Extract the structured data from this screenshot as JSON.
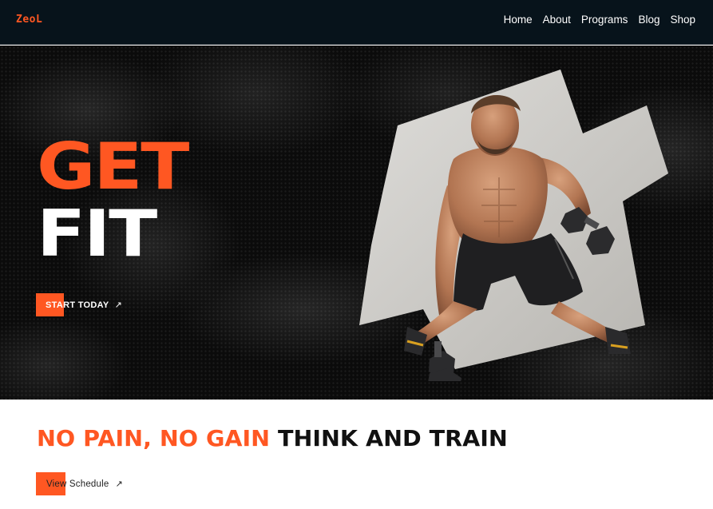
{
  "brand": {
    "logo": "ZeoL"
  },
  "nav": {
    "items": [
      {
        "label": "Home"
      },
      {
        "label": "About"
      },
      {
        "label": "Programs"
      },
      {
        "label": "Blog"
      },
      {
        "label": "Shop"
      }
    ]
  },
  "hero": {
    "title_line1": "GET",
    "title_line2": "FIT",
    "cta_label": "START TODAY",
    "cta_icon": "arrow-up-right-icon",
    "image": "athlete-dumbbell-pushup-photo"
  },
  "section": {
    "tagline_orange": "NO PAIN, NO GAIN",
    "tagline_dark": "THINK AND TRAIN",
    "button_label": "View Schedule",
    "button_icon": "arrow-up-right-icon"
  },
  "colors": {
    "accent": "#ff5722",
    "nav_bg": "#07131b",
    "hero_bg": "#0b0b0b",
    "text_light": "#ffffff",
    "text_dark": "#111111"
  }
}
